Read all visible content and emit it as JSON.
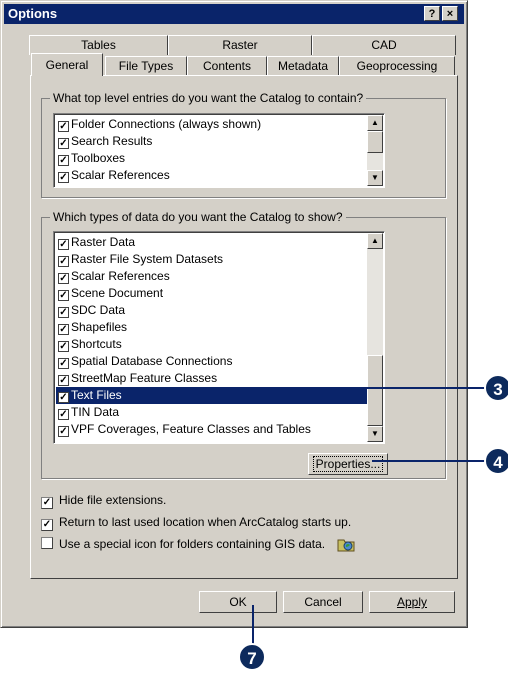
{
  "window": {
    "title": "Options",
    "help_btn": "?",
    "close_btn": "×"
  },
  "tabs_back": [
    "Tables",
    "Raster",
    "CAD"
  ],
  "tabs_front": [
    "General",
    "File Types",
    "Contents",
    "Metadata",
    "Geoprocessing"
  ],
  "active_tab": "General",
  "group_top": {
    "legend": "What top level entries do you want the Catalog to contain?",
    "items": [
      "Folder Connections (always shown)",
      "Search Results",
      "Toolboxes",
      "Scalar References"
    ]
  },
  "group_types": {
    "legend": "Which types of data do you want the Catalog to show?",
    "items": [
      "Raster Data",
      "Raster File System Datasets",
      "Scalar References",
      "Scene Document",
      "SDC Data",
      "Shapefiles",
      "Shortcuts",
      "Spatial Database Connections",
      "StreetMap Feature Classes",
      "Text Files",
      "TIN Data",
      "VPF Coverages, Feature Classes and Tables"
    ],
    "selected": "Text Files",
    "properties_label": "Properties..."
  },
  "options": [
    {
      "label": "Hide file extensions.",
      "checked": true
    },
    {
      "label": "Return to last used location when ArcCatalog starts up.",
      "checked": true
    },
    {
      "label": "Use a special icon for folders containing GIS data.",
      "checked": false
    }
  ],
  "buttons": {
    "ok": "OK",
    "cancel": "Cancel",
    "apply": "Apply"
  },
  "callouts": {
    "c3": "3",
    "c4": "4",
    "c7": "7"
  },
  "colors": {
    "accent": "#0a246a",
    "face": "#d4d0c8",
    "callout": "#0d2a5c"
  }
}
